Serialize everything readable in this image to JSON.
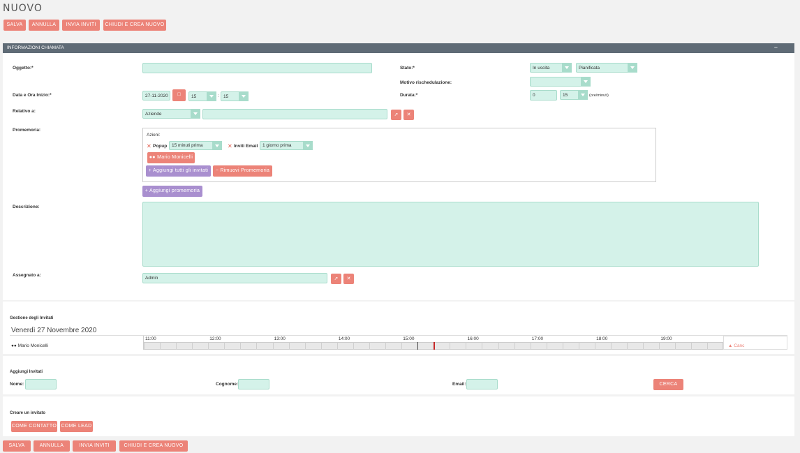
{
  "page": {
    "title": "NUOVO"
  },
  "toolbar": {
    "save": "SALVA",
    "cancel": "ANNULLA",
    "send_invites": "INVIA INVITI",
    "close_new": "CHIUDI E CREA NUOVO"
  },
  "section": {
    "title": "INFORMAZIONI CHIAMATA",
    "collapse": "−"
  },
  "form": {
    "subject_label": "Oggetto:*",
    "subject_value": "",
    "status_label": "Stato:*",
    "status_direction": "In uscita",
    "status_value": "Pianificata",
    "reschedule_label": "Motivo rischedulazione:",
    "reschedule_value": "",
    "start_label": "Data e Ora Inizio:*",
    "start_date": "27-11-2020",
    "start_hour": "15",
    "start_sep": ":",
    "start_min": "15",
    "duration_label": "Durata:*",
    "duration_hours": "0",
    "duration_min": "15",
    "duration_unit": "(ore/minuti)",
    "related_label": "Relativo a:",
    "related_type": "Aziende",
    "related_value": "",
    "reminder_label": "Promemoria:",
    "actions_label": "Azioni:",
    "popup_label": "Popup",
    "popup_value": "15 minuti prima",
    "email_label": "Inviti Email",
    "email_value": "1 giorno prima",
    "invitee": "Mario Monicelli",
    "add_all": "Aggiungi tutti gli invitati",
    "remove_reminder": "Rimuovi Promemoria",
    "add_reminder": "Aggiungi promemoria",
    "description_label": "Descrizione:",
    "description_value": "",
    "assigned_label": "Assegnato a:",
    "assigned_value": "Admin"
  },
  "scheduler": {
    "title": "Gestione degli Invitati",
    "date": "Venerdì 27 Novembre 2020",
    "hours": [
      "11:00",
      "12:00",
      "13:00",
      "14:00",
      "15:00",
      "16:00",
      "17:00",
      "18:00",
      "19:00"
    ],
    "invitee": "Mario Monicelli",
    "remove": "Canc"
  },
  "add_invitees": {
    "title": "Aggiungi Invitati",
    "first_name_label": "Nome:",
    "last_name_label": "Cognome:",
    "email_label": "Email:",
    "search": "CERCA"
  },
  "create_invitee": {
    "title": "Creare un invitato",
    "as_contact": "COME CONTATTO",
    "as_lead": "COME LEAD"
  },
  "colors": {
    "accent": "#ec8378",
    "field": "#d4f2e9",
    "header": "#5f6b76",
    "purple": "#a98fcf"
  }
}
